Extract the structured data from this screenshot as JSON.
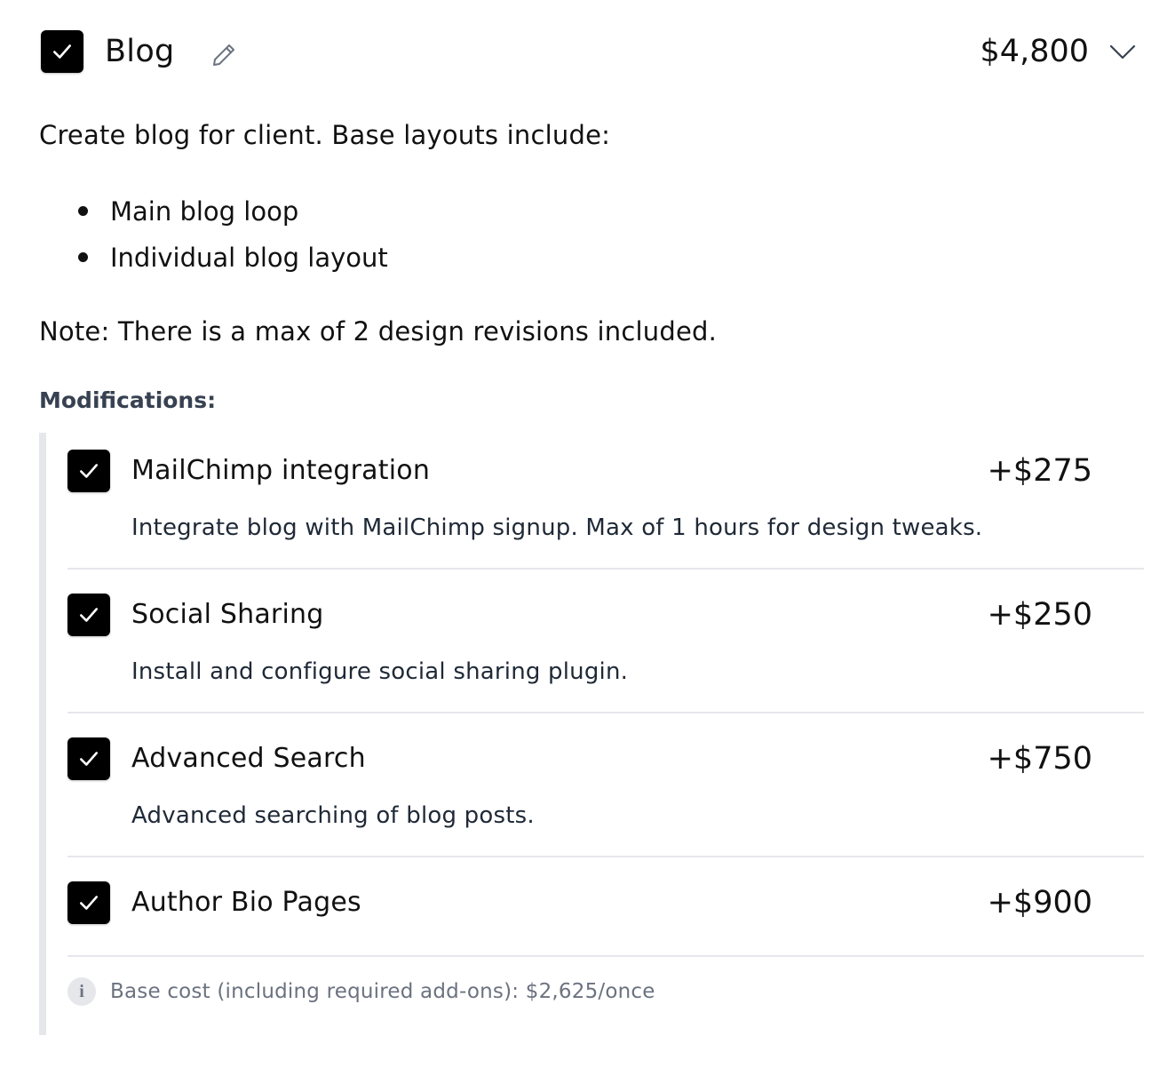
{
  "item": {
    "title": "Blog",
    "price": "$4,800",
    "checked": true,
    "description": "Create blog for client. Base layouts include:",
    "layouts": [
      "Main blog loop",
      "Individual blog layout"
    ],
    "note": "Note: There is a max of 2 design revisions included.",
    "icons": {
      "edit": "pencil-icon",
      "toggle": "chevron-down-icon",
      "check": "checkmark-icon"
    }
  },
  "modifications": {
    "heading": "Modifications:",
    "items": [
      {
        "title": "MailChimp integration",
        "price": "+$275",
        "description": "Integrate blog with MailChimp signup. Max of 1 hours for design tweaks.",
        "checked": true
      },
      {
        "title": "Social Sharing",
        "price": "+$250",
        "description": "Install and configure social sharing plugin.",
        "checked": true
      },
      {
        "title": "Advanced Search",
        "price": "+$750",
        "description": "Advanced searching of blog posts.",
        "checked": true
      },
      {
        "title": "Author Bio Pages",
        "price": "+$900",
        "description": "",
        "checked": true
      }
    ],
    "footer": {
      "icon": "i",
      "text": "Base cost (including required add-ons): $2,625/once"
    }
  },
  "colors": {
    "checkbox": "#000000",
    "muted": "#6b7280",
    "divider": "#e5e7eb",
    "heading": "#374151"
  }
}
